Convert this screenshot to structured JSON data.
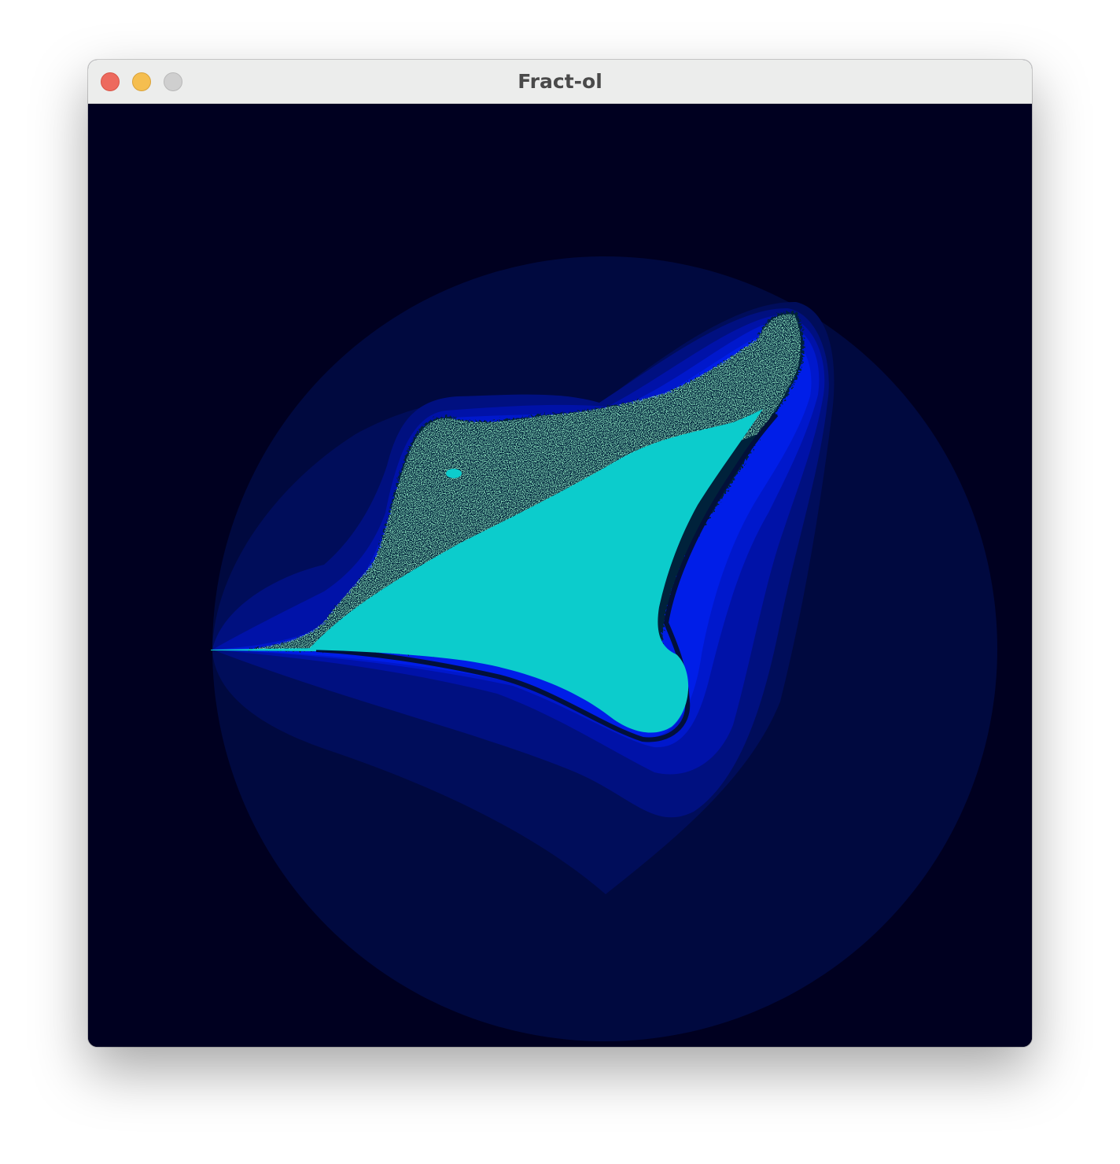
{
  "window": {
    "title": "Fract-ol",
    "buttons": {
      "close": "close-icon",
      "minimize": "minimize-icon",
      "zoom": "zoom-icon"
    }
  },
  "fractal": {
    "colors": {
      "background": "#000020",
      "outer_band": "#00093f",
      "band_1": "#000d5a",
      "band_2": "#001080",
      "band_3": "#0012a8",
      "band_4": "#0018cc",
      "band_5": "#001ee8",
      "edge": "#05203a",
      "interior": "#0ccccc",
      "speckle": "#3aa070"
    }
  }
}
